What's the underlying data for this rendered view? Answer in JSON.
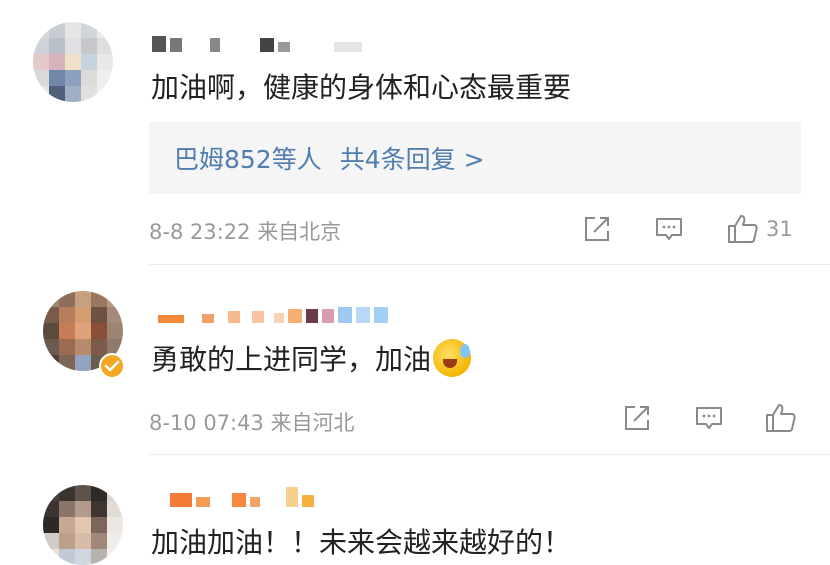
{
  "comments": [
    {
      "text": "加油啊，健康的身体和心态最重要",
      "replies": {
        "names": "巴姆852等人",
        "count_label": "共4条回复 >"
      },
      "date": "8-8 23:22",
      "source": "来自北京",
      "likes": "31",
      "has_emoji": false
    },
    {
      "text": "勇敢的上进同学，加油",
      "date": "8-10 07:43",
      "source": "来自河北",
      "has_emoji": true,
      "emoji_name": "crying-laughing-emoji"
    },
    {
      "text": "加油加油！！未来会越来越好的！"
    }
  ],
  "colors": {
    "link": "#507daf",
    "meta": "#999999",
    "body_text": "#222222",
    "replies_bg": "#f5f5f5",
    "divider": "#ececec",
    "verified_badge": "#f5a623"
  },
  "icons": {
    "share": "share-icon",
    "comment": "comment-icon",
    "like": "like-thumb-icon",
    "verified": "verified-badge-icon"
  }
}
